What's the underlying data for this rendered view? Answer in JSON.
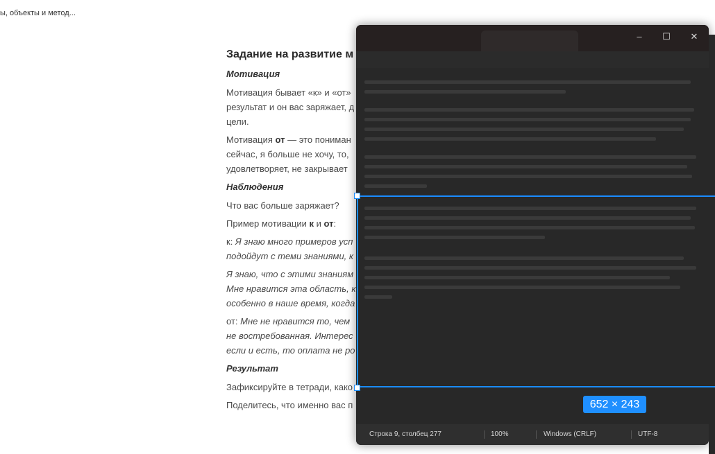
{
  "breadcrumb": "ы, объекты и метод...",
  "doc": {
    "heading": "Задание на развитие м",
    "motivation_title": "Мотивация",
    "p1_line1": "Мотивация бывает «к» и «от»",
    "p1_line2": "результат и он вас заряжает, д",
    "p1_line3": "цели.",
    "p2_line1_a": "Мотивация ",
    "p2_line1_b": "от",
    "p2_line1_c": " — это пониман",
    "p2_line2": "сейчас, я больше не хочу, то,",
    "p2_line3": "удовлетворяет, не закрывает",
    "observations_title": "Наблюдения",
    "q1": "Что вас больше заряжает?",
    "example_a": "Пример мотивации ",
    "example_k": "к",
    "example_and": " и ",
    "example_ot": "от",
    "example_colon": ":",
    "k_label": "к: ",
    "k_line1": "Я знаю много примеров усп",
    "k_line2": "подойдут с теми знаниями, к",
    "k2_line1": "Я знаю, что с этими знаниям",
    "k2_line2": "Мне нравится эта область, к",
    "k2_line3": "особенно в наше время, когда",
    "ot_label": "от: ",
    "ot_line1": "Мне не нравится то, чем",
    "ot_line2": "не востребованная. Интерес",
    "ot_line3": "если и есть, то оплата не ро",
    "result_title": "Результат",
    "r1": "Зафиксируйте в тетради, како",
    "r2": "Поделитесь, что именно вас п"
  },
  "window": {
    "minimize": "–",
    "maximize": "☐",
    "close": "✕"
  },
  "status": {
    "position": "Строка 9, столбец 277",
    "zoom": "100%",
    "line_endings": "Windows (CRLF)",
    "encoding": "UTF-8"
  },
  "selection": {
    "size_label": "652 × 243"
  },
  "colors": {
    "accent": "#1a8cff",
    "editor_bg": "#282828"
  }
}
